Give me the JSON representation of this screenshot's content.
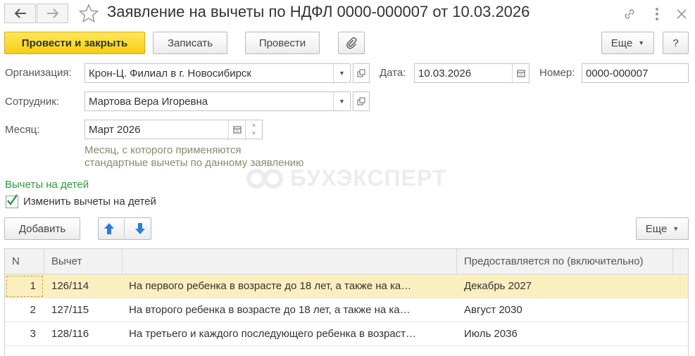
{
  "window": {
    "title": "Заявление на вычеты по НДФЛ 0000-000007 от 10.03.2026"
  },
  "toolbar": {
    "post_close": "Провести и закрыть",
    "save": "Записать",
    "post": "Провести",
    "more": "Еще",
    "help": "?"
  },
  "form": {
    "org_label": "Организация:",
    "org_value": "Крон-Ц. Филиал в г. Новосибирск",
    "date_label": "Дата:",
    "date_value": "10.03.2026",
    "number_label": "Номер:",
    "number_value": "0000-000007",
    "employee_label": "Сотрудник:",
    "employee_value": "Мартова Вера Игоревна",
    "month_label": "Месяц:",
    "month_value": "Март 2026",
    "hint_line1": "Месяц, с которого применяются",
    "hint_line2": "стандартные вычеты по данному заявлению"
  },
  "watermark": "БУХЭКСПЕРТ",
  "children": {
    "section_title": "Вычеты на детей",
    "change_label": "Изменить вычеты на детей",
    "change_checked": true,
    "add_button": "Добавить",
    "more": "Еще"
  },
  "table": {
    "columns": [
      "N",
      "Вычет",
      "",
      "Предоставляется по (включительно)"
    ],
    "rows": [
      {
        "n": "1",
        "code": "126/114",
        "description": "На первого ребенка в возрасте до 18 лет, а также на ка…",
        "until": "Декабрь 2027"
      },
      {
        "n": "2",
        "code": "127/115",
        "description": "На второго ребенка в возрасте до 18 лет, а также на ка…",
        "until": "Август 2030"
      },
      {
        "n": "3",
        "code": "128/116",
        "description": "На третьего и каждого последующего ребенка в возраст…",
        "until": "Июль 2036"
      }
    ]
  },
  "colors": {
    "primary_button": "#f5cf14",
    "section_title": "#2d9a3a",
    "selected_row": "#fbefc0",
    "hint_text": "#8a8a6a"
  }
}
